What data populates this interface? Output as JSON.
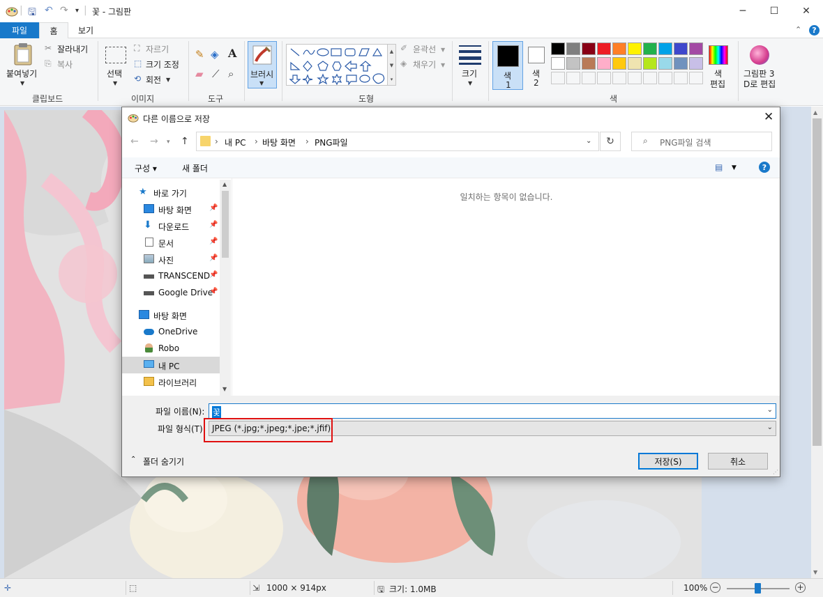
{
  "window": {
    "title": "꽃 - 그림판",
    "tabs": {
      "file": "파일",
      "home": "홈",
      "view": "보기"
    }
  },
  "ribbon": {
    "clipboard": {
      "paste": "붙여넣기",
      "cut": "잘라내기",
      "copy": "복사",
      "group": "클립보드"
    },
    "image": {
      "select": "선택",
      "crop": "자르기",
      "resize": "크기 조정",
      "rotate": "회전",
      "group": "이미지"
    },
    "tools": {
      "group": "도구"
    },
    "brushes": {
      "label": "브러시"
    },
    "shapes": {
      "outline": "윤곽선",
      "fill": "채우기",
      "group": "도형"
    },
    "size": {
      "label": "크기"
    },
    "colors": {
      "color1_a": "색",
      "color1_b": "1",
      "color2_a": "색",
      "color2_b": "2",
      "edit_a": "색",
      "edit_b": "편집",
      "group": "색",
      "palette_row1": [
        "#000000",
        "#7f7f7f",
        "#880015",
        "#ed1c24",
        "#ff7f27",
        "#fff200",
        "#22b14c",
        "#00a2e8",
        "#3f48cc",
        "#a349a4"
      ],
      "palette_row2": [
        "#ffffff",
        "#c3c3c3",
        "#b97a57",
        "#ffaec9",
        "#ffc90e",
        "#efe4b0",
        "#b5e61d",
        "#99d9ea",
        "#7092be",
        "#c8bfe7"
      ]
    },
    "paint3d": {
      "line1": "그림판 3",
      "line2": "D로 편집"
    }
  },
  "dialog": {
    "title": "다른 이름으로 저장",
    "address": {
      "c1": "내 PC",
      "c2": "바탕 화면",
      "c3": "PNG파일"
    },
    "search_placeholder": "PNG파일 검색",
    "toolbar": {
      "organize": "구성 ▾",
      "new_folder": "새 폴더"
    },
    "nav": {
      "quick_access": "바로 가기",
      "desktop_pin": "바탕 화면",
      "downloads": "다운로드",
      "documents": "문서",
      "pictures": "사진",
      "transcend": "TRANSCEND",
      "gdrive": "Google Drive",
      "desktop": "바탕 화면",
      "onedrive": "OneDrive",
      "robo": "Robo",
      "mypc": "내 PC",
      "libraries": "라이브러리"
    },
    "empty_message": "일치하는 항목이 없습니다.",
    "filename_label": "파일 이름(N):",
    "filename_value": "꽃",
    "filetype_label": "파일 형식(T):",
    "filetype_value": "JPEG (*.jpg;*.jpeg;*.jpe;*.jfif)",
    "hide_folders": "폴더 숨기기",
    "save": "저장(S)",
    "cancel": "취소"
  },
  "status": {
    "dimensions": "1000 × 914px",
    "size": "크기: 1.0MB",
    "zoom": "100%"
  }
}
